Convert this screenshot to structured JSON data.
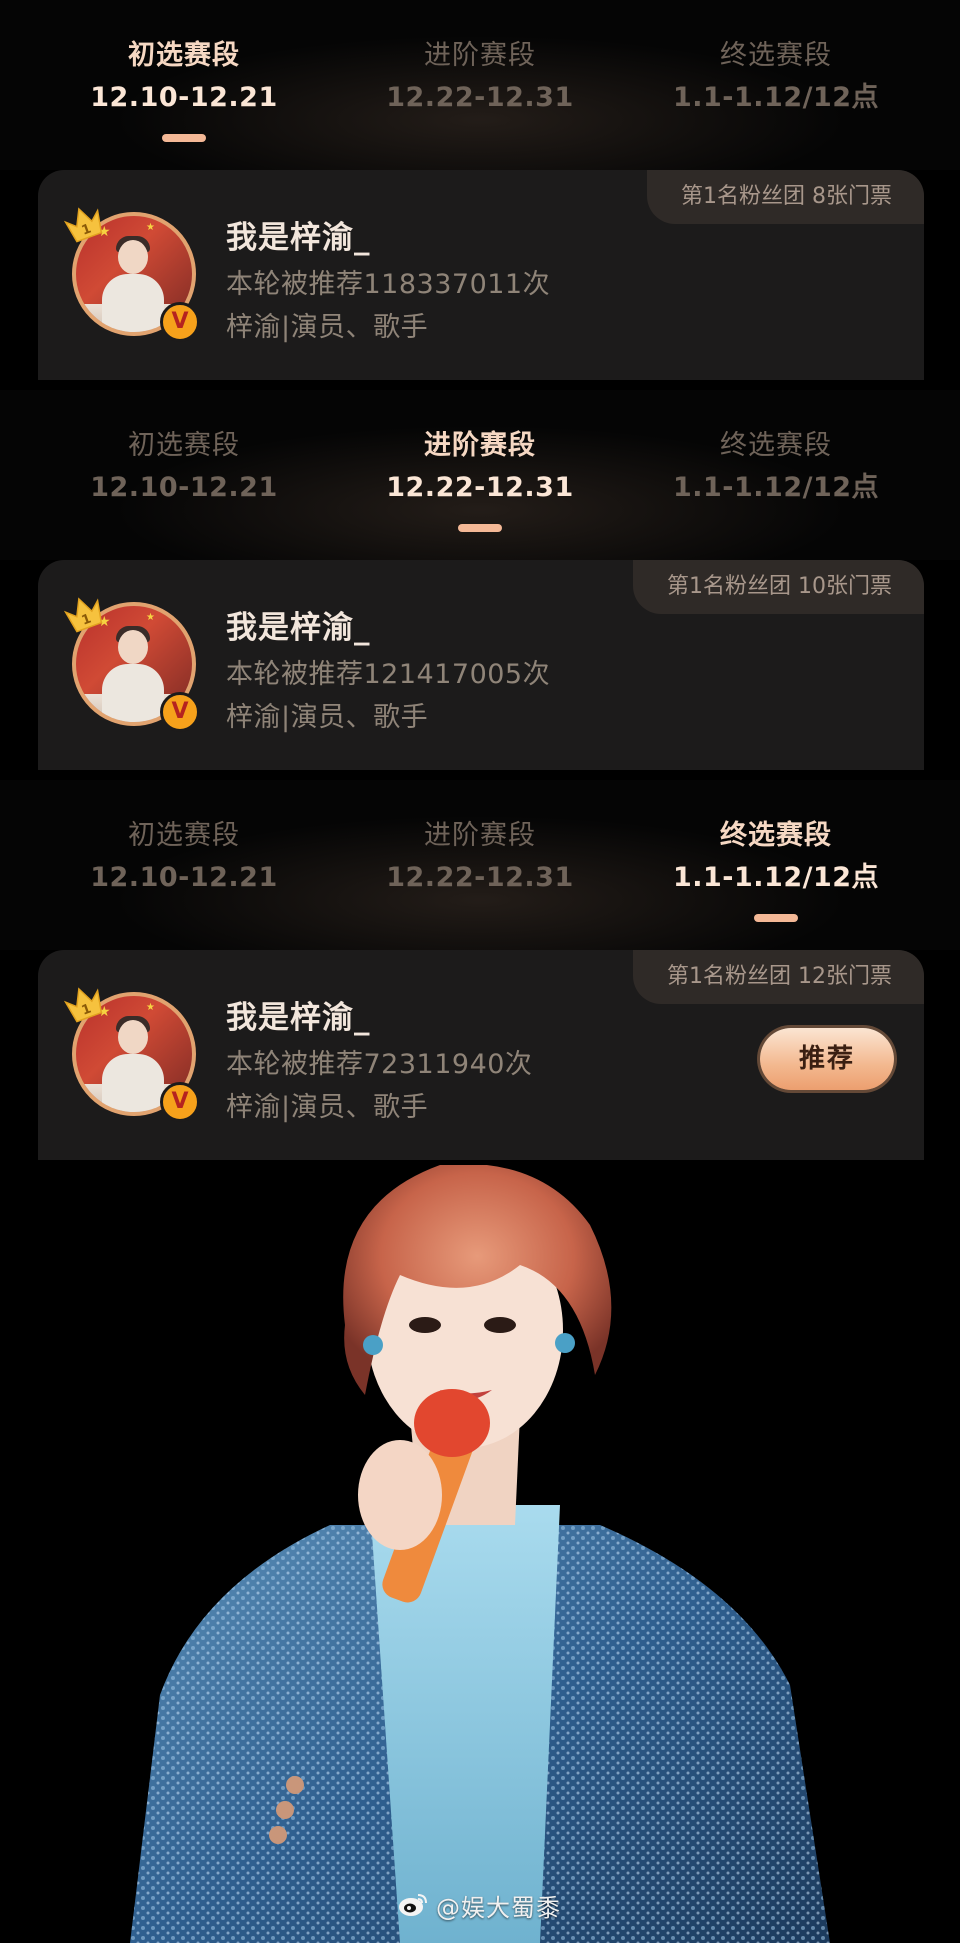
{
  "stages": [
    {
      "tabs": [
        {
          "name": "初选赛段",
          "date": "12.10-12.21",
          "active": true
        },
        {
          "name": "进阶赛段",
          "date": "12.22-12.31",
          "active": false
        },
        {
          "name": "终选赛段",
          "date": "1.1-1.12/12点",
          "active": false
        }
      ],
      "card": {
        "badge": "第1名粉丝团 8张门票",
        "name": "我是梓渝_",
        "recommend": "本轮被推荐118337011次",
        "desc": "梓渝|演员、歌手",
        "rank": "1",
        "verified": "V"
      }
    },
    {
      "tabs": [
        {
          "name": "初选赛段",
          "date": "12.10-12.21",
          "active": false
        },
        {
          "name": "进阶赛段",
          "date": "12.22-12.31",
          "active": true
        },
        {
          "name": "终选赛段",
          "date": "1.1-1.12/12点",
          "active": false
        }
      ],
      "card": {
        "badge": "第1名粉丝团 10张门票",
        "name": "我是梓渝_",
        "recommend": "本轮被推荐121417005次",
        "desc": "梓渝|演员、歌手",
        "rank": "1",
        "verified": "V"
      }
    },
    {
      "tabs": [
        {
          "name": "初选赛段",
          "date": "12.10-12.21",
          "active": false
        },
        {
          "name": "进阶赛段",
          "date": "12.22-12.31",
          "active": false
        },
        {
          "name": "终选赛段",
          "date": "1.1-1.12/12点",
          "active": true
        }
      ],
      "card": {
        "badge": "第1名粉丝团 12张门票",
        "name": "我是梓渝_",
        "recommend": "本轮被推荐72311940次",
        "desc": "梓渝|演员、歌手",
        "rank": "1",
        "verified": "V",
        "button": "推荐"
      }
    }
  ],
  "watermark": {
    "icon": "weibo-logo-icon",
    "text": "@娱大蜀黍"
  },
  "colors": {
    "background": "#000000",
    "card": "#1c1b1b",
    "accent": "#f4b896",
    "active_text": "#f6d8c3",
    "inactive_text": "#6f6359",
    "muted_text": "#8f8478"
  }
}
